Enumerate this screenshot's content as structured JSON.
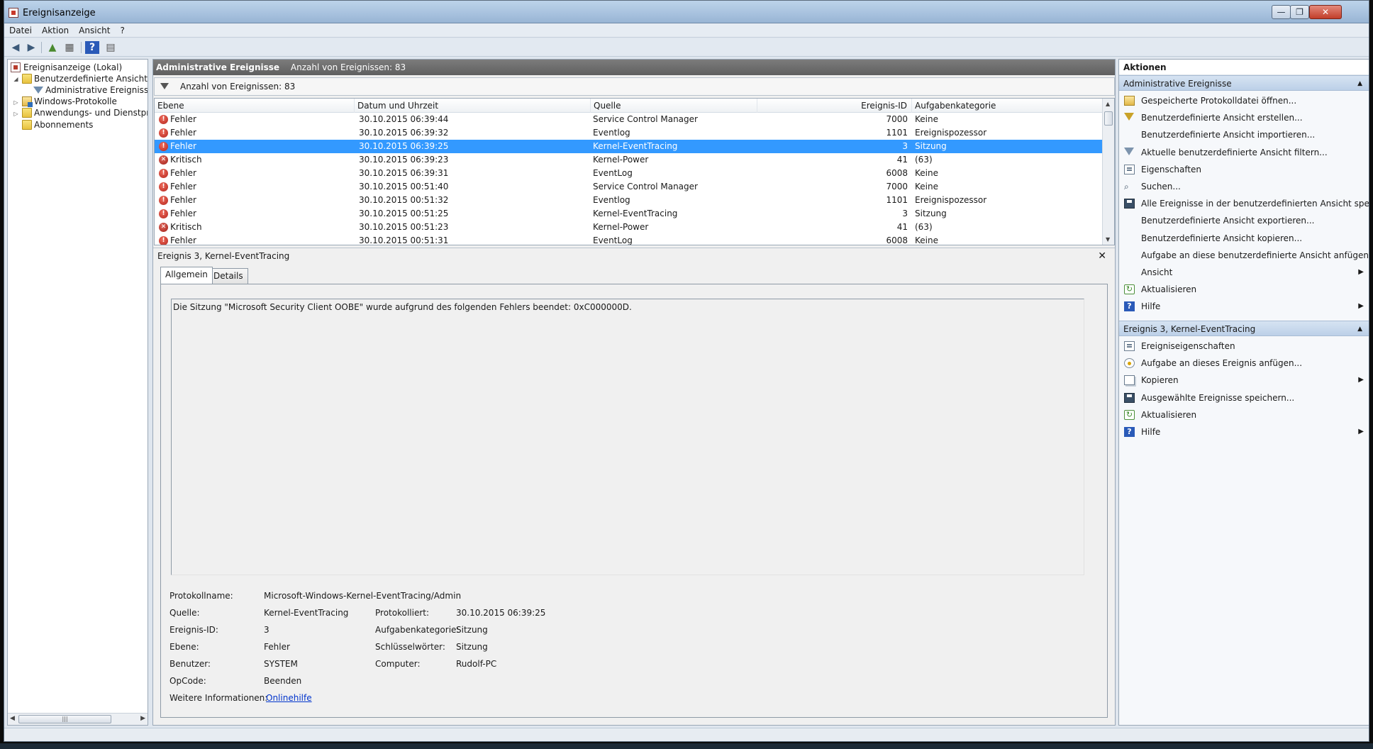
{
  "window": {
    "title": "Ereignisanzeige",
    "min_glyph": "—",
    "max_glyph": "❐",
    "close_glyph": "✕"
  },
  "menu": {
    "items": [
      "Datei",
      "Aktion",
      "Ansicht",
      "?"
    ]
  },
  "tree": {
    "items": [
      {
        "label": "Ereignisanzeige (Lokal)"
      },
      {
        "label": "Benutzerdefinierte Ansichten"
      },
      {
        "label": "Administrative Ereignisse"
      },
      {
        "label": "Windows-Protokolle"
      },
      {
        "label": "Anwendungs- und Dienstprotokolle"
      },
      {
        "label": "Abonnements"
      }
    ]
  },
  "center": {
    "title": "Administrative Ereignisse",
    "count_text": "Anzahl von Ereignissen: 83",
    "filter_text": "Anzahl von Ereignissen: 83"
  },
  "grid": {
    "columns": [
      "Ebene",
      "Datum und Uhrzeit",
      "Quelle",
      "Ereignis-ID",
      "Aufgabenkategorie"
    ],
    "rows": [
      {
        "level": "Fehler",
        "date": "30.10.2015 06:39:44",
        "source": "Service Control Manager",
        "id": "7000",
        "category": "Keine"
      },
      {
        "level": "Fehler",
        "date": "30.10.2015 06:39:32",
        "source": "Eventlog",
        "id": "1101",
        "category": "Ereignispozessor"
      },
      {
        "level": "Fehler",
        "date": "30.10.2015 06:39:25",
        "source": "Kernel-EventTracing",
        "id": "3",
        "category": "Sitzung"
      },
      {
        "level": "Kritisch",
        "date": "30.10.2015 06:39:23",
        "source": "Kernel-Power",
        "id": "41",
        "category": "(63)"
      },
      {
        "level": "Fehler",
        "date": "30.10.2015 06:39:31",
        "source": "EventLog",
        "id": "6008",
        "category": "Keine"
      },
      {
        "level": "Fehler",
        "date": "30.10.2015 00:51:40",
        "source": "Service Control Manager",
        "id": "7000",
        "category": "Keine"
      },
      {
        "level": "Fehler",
        "date": "30.10.2015 00:51:32",
        "source": "Eventlog",
        "id": "1101",
        "category": "Ereignispozessor"
      },
      {
        "level": "Fehler",
        "date": "30.10.2015 00:51:25",
        "source": "Kernel-EventTracing",
        "id": "3",
        "category": "Sitzung"
      },
      {
        "level": "Kritisch",
        "date": "30.10.2015 00:51:23",
        "source": "Kernel-Power",
        "id": "41",
        "category": "(63)"
      },
      {
        "level": "Fehler",
        "date": "30.10.2015 00:51:31",
        "source": "EventLog",
        "id": "6008",
        "category": "Keine"
      }
    ]
  },
  "details": {
    "title": "Ereignis 3, Kernel-EventTracing",
    "tabs": [
      "Allgemein",
      "Details"
    ],
    "message": "Die Sitzung \"Microsoft Security Client OOBE\" wurde aufgrund des folgenden Fehlers beendet: 0xC000000D.",
    "fields": {
      "logname_label": "Protokollname:",
      "logname": "Microsoft-Windows-Kernel-EventTracing/Admin",
      "source_label": "Quelle:",
      "source": "Kernel-EventTracing",
      "logged_label": "Protokolliert:",
      "logged": "30.10.2015 06:39:25",
      "id_label": "Ereignis-ID:",
      "id": "3",
      "category_label": "Aufgabenkategorie:",
      "category": "Sitzung",
      "level_label": "Ebene:",
      "level": "Fehler",
      "keywords_label": "Schlüsselwörter:",
      "keywords": "Sitzung",
      "user_label": "Benutzer:",
      "user": "SYSTEM",
      "computer_label": "Computer:",
      "computer": "Rudolf-PC",
      "opcode_label": "OpCode:",
      "opcode": "Beenden",
      "info_label": "Weitere Informationen:",
      "info_link": "Onlinehilfe"
    }
  },
  "actions": {
    "title": "Aktionen",
    "section1": {
      "title": "Administrative Ereignisse",
      "items": [
        {
          "label": "Gespeicherte Protokolldatei öffnen...",
          "icon": "open-log-icon"
        },
        {
          "label": "Benutzerdefinierte Ansicht erstellen...",
          "icon": "create-view-icon"
        },
        {
          "label": "Benutzerdefinierte Ansicht importieren...",
          "icon": ""
        },
        {
          "label": "Aktuelle benutzerdefinierte Ansicht filtern...",
          "icon": "filter-icon"
        },
        {
          "label": "Eigenschaften",
          "icon": "properties-icon"
        },
        {
          "label": "Suchen...",
          "icon": "find-icon"
        },
        {
          "label": "Alle Ereignisse in der benutzerdefinierten Ansicht speic...",
          "icon": "save-icon"
        },
        {
          "label": "Benutzerdefinierte Ansicht exportieren...",
          "icon": ""
        },
        {
          "label": "Benutzerdefinierte Ansicht kopieren...",
          "icon": ""
        },
        {
          "label": "Aufgabe an diese benutzerdefinierte Ansicht anfügen...",
          "icon": ""
        },
        {
          "label": "Ansicht",
          "icon": "",
          "submenu": true
        },
        {
          "label": "Aktualisieren",
          "icon": "refresh-icon"
        },
        {
          "label": "Hilfe",
          "icon": "help-icon",
          "submenu": true
        }
      ]
    },
    "section2": {
      "title": "Ereignis 3, Kernel-EventTracing",
      "items": [
        {
          "label": "Ereigniseigenschaften",
          "icon": "event-properties-icon"
        },
        {
          "label": "Aufgabe an dieses Ereignis anfügen...",
          "icon": "attach-task-icon"
        },
        {
          "label": "Kopieren",
          "icon": "copy-icon",
          "submenu": true
        },
        {
          "label": "Ausgewählte Ereignisse speichern...",
          "icon": "save-icon"
        },
        {
          "label": "Aktualisieren",
          "icon": "refresh-icon"
        },
        {
          "label": "Hilfe",
          "icon": "help-icon",
          "submenu": true
        }
      ]
    }
  },
  "colors": {
    "selection": "#3399ff",
    "accent": "#bcd0e8",
    "header_bar": "#6b6b6b"
  }
}
